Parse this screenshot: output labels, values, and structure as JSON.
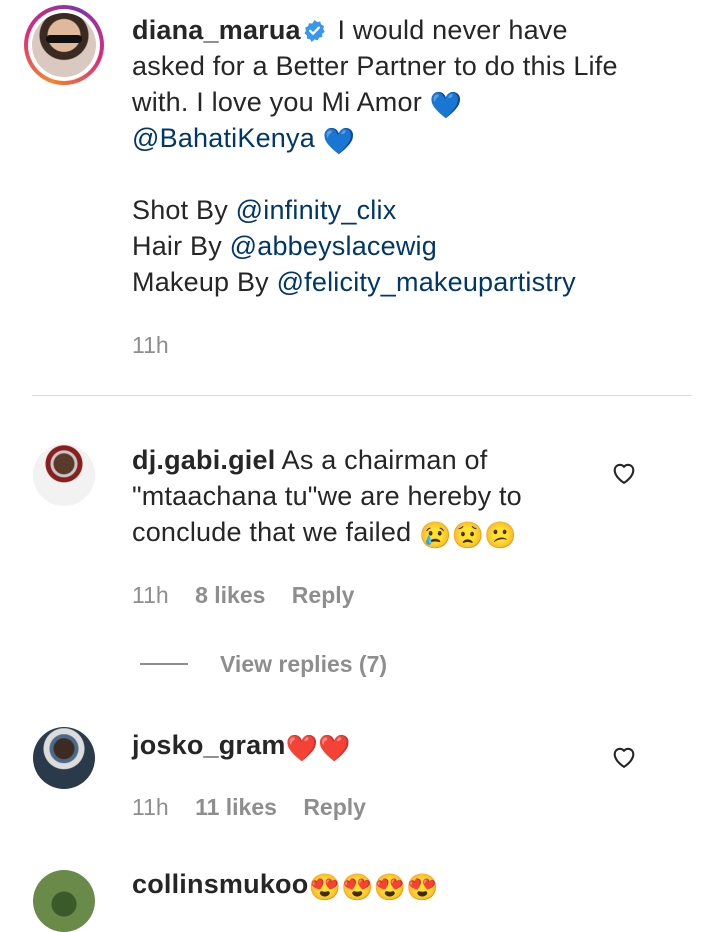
{
  "caption": {
    "username": "diana_marua",
    "line1": " I would never have",
    "line2": "asked for a Better Partner to do this Life",
    "line3": "with. I love you Mi Amor ",
    "emoji_heart1": "💙",
    "mention_bahati": "@BahatiKenya",
    "emoji_heart2": "💙",
    "shot_by": "Shot By ",
    "shot_by_mention": "@infinity_clix",
    "hair_by": "Hair By ",
    "hair_by_mention": "@abbeyslacewig",
    "makeup_by": "Makeup By ",
    "makeup_by_mention": "@felicity_makeupartistry",
    "time": "11h"
  },
  "comments": [
    {
      "username": "dj.gabi.giel",
      "line1": " As a chairman of",
      "line2": "\"mtaachana tu\"we are hereby to",
      "line3": "conclude that we failed ",
      "emojis": "😢😟😕",
      "time": "11h",
      "likes": "8 likes",
      "reply": "Reply",
      "view_replies": "View replies (7)"
    },
    {
      "username": "josko_gram",
      "emojis": " ❤️❤️",
      "time": "11h",
      "likes": "11 likes",
      "reply": "Reply"
    },
    {
      "username": "collinsmukoo",
      "emojis": " 😍😍😍😍"
    }
  ],
  "icons": {
    "verified": "verified-badge-icon",
    "like": "heart-outline-icon"
  },
  "colors": {
    "mention": "#00376b",
    "meta": "#8e8e8e",
    "verified": "#3897f0",
    "divider": "#dbdbdb"
  }
}
